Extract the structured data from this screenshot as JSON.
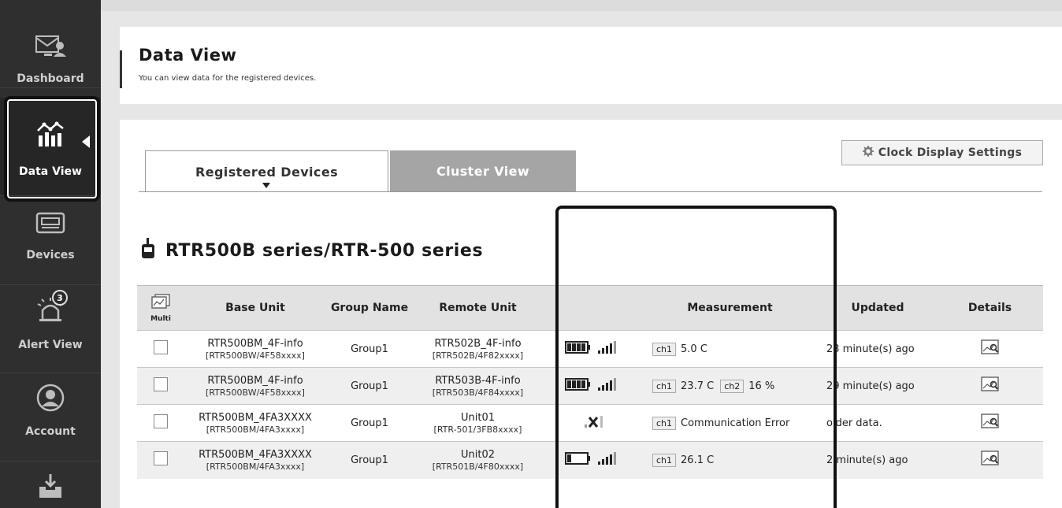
{
  "sidebar": {
    "items": [
      {
        "label": "Dashboard",
        "icon": "monitor-user-icon"
      },
      {
        "label": "Data View",
        "icon": "chart-bars-icon",
        "active": true
      },
      {
        "label": "Devices",
        "icon": "device-icon"
      },
      {
        "label": "Alert View",
        "icon": "alarm-icon",
        "badge": "3"
      },
      {
        "label": "Account",
        "icon": "user-icon"
      },
      {
        "label": "",
        "icon": "download-icon"
      }
    ]
  },
  "header": {
    "title": "Data View",
    "subtitle": "You can view data for the registered devices."
  },
  "tabs": [
    {
      "label": "Registered Devices",
      "active": true
    },
    {
      "label": "Cluster View",
      "active": false
    }
  ],
  "clock_button": {
    "label": "Clock Display Settings"
  },
  "section": {
    "title": "RTR500B series/RTR-500 series"
  },
  "table": {
    "multi_label": "Multi",
    "headers": {
      "base_unit": "Base Unit",
      "group_name": "Group Name",
      "remote_unit": "Remote Unit",
      "measurement": "Measurement",
      "updated": "Updated",
      "details": "Details"
    },
    "rows": [
      {
        "base_unit": "RTR500BM_4F-info",
        "base_unit_sub": "[RTR500BW/4F58xxxx]",
        "group": "Group1",
        "remote_unit": "RTR502B_4F-info",
        "remote_unit_sub": "[RTR502B/4F82xxxx]",
        "battery": "full",
        "signal": "strong",
        "ch1_label": "ch1",
        "ch1_value": "5.0 C",
        "ch2_label": "",
        "ch2_value": "",
        "updated": "23 minute(s) ago"
      },
      {
        "base_unit": "RTR500BM_4F-info",
        "base_unit_sub": "[RTR500BW/4F58xxxx]",
        "group": "Group1",
        "remote_unit": "RTR503B-4F-info",
        "remote_unit_sub": "[RTR503B/4F84xxxx]",
        "battery": "full",
        "signal": "strong",
        "ch1_label": "ch1",
        "ch1_value": "23.7 C",
        "ch2_label": "ch2",
        "ch2_value": "16 %",
        "updated": "29 minute(s) ago"
      },
      {
        "base_unit": "RTR500BM_4FA3XXXX",
        "base_unit_sub": "[RTR500BM/4FA3xxxx]",
        "group": "Group1",
        "remote_unit": "Unit01",
        "remote_unit_sub": "[RTR-501/3FB8xxxx]",
        "battery": "none",
        "signal": "error",
        "ch1_label": "ch1",
        "ch1_value": "Communication Error",
        "ch2_label": "",
        "ch2_value": "",
        "updated": "older data."
      },
      {
        "base_unit": "RTR500BM_4FA3XXXX",
        "base_unit_sub": "[RTR500BM/4FA3xxxx]",
        "group": "Group1",
        "remote_unit": "Unit02",
        "remote_unit_sub": "[RTR501B/4F80xxxx]",
        "battery": "low",
        "signal": "strong",
        "ch1_label": "ch1",
        "ch1_value": "26.1 C",
        "ch2_label": "",
        "ch2_value": "",
        "updated": "2 minute(s) ago"
      }
    ]
  }
}
